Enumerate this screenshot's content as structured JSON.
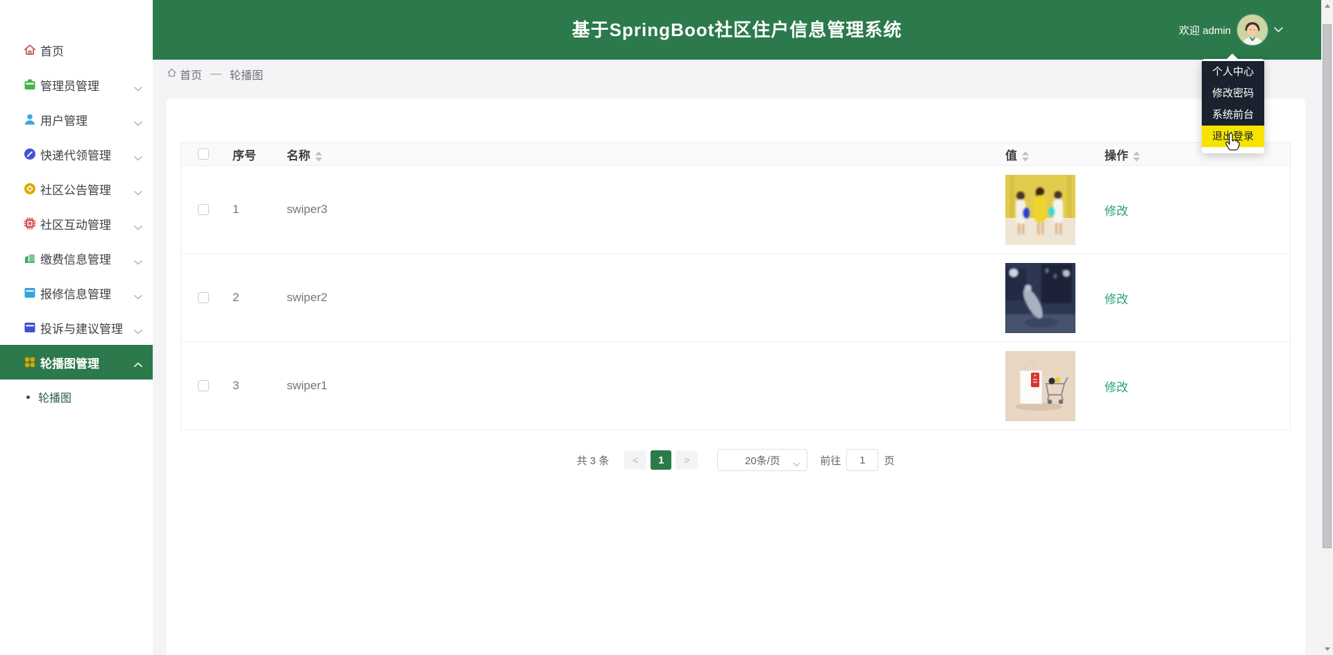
{
  "app": {
    "title": "基于SpringBoot社区住户信息管理系统",
    "welcome": "欢迎 admin"
  },
  "user_menu": {
    "items": [
      {
        "label": "个人中心"
      },
      {
        "label": "修改密码"
      },
      {
        "label": "系统前台"
      },
      {
        "label": "退出登录",
        "highlighted": true
      }
    ]
  },
  "sidebar": {
    "items": [
      {
        "label": "首页",
        "icon": "home-icon",
        "icon_color": "#c4564e",
        "expandable": false
      },
      {
        "label": "管理员管理",
        "icon": "toolbox-icon",
        "icon_color": "#44b549",
        "expandable": true
      },
      {
        "label": "用户管理",
        "icon": "user-icon",
        "icon_color": "#3aa7e0",
        "expandable": true
      },
      {
        "label": "快递代领管理",
        "icon": "pen-circle-icon",
        "icon_color": "#4353d9",
        "expandable": true
      },
      {
        "label": "社区公告管理",
        "icon": "coin-icon",
        "icon_color": "#dfa800",
        "expandable": true
      },
      {
        "label": "社区互动管理",
        "icon": "chip-icon",
        "icon_color": "#d9534f",
        "expandable": true
      },
      {
        "label": "缴费信息管理",
        "icon": "buildings-icon",
        "icon_color": "#3fae60",
        "expandable": true
      },
      {
        "label": "报修信息管理",
        "icon": "window-icon",
        "icon_color": "#36a3dd",
        "expandable": true
      },
      {
        "label": "投诉与建议管理",
        "icon": "window-icon",
        "icon_color": "#3f51cf",
        "expandable": true
      },
      {
        "label": "轮播图管理",
        "icon": "clover-icon",
        "icon_color": "#d7a400",
        "expandable": true,
        "expanded": true,
        "selected": true
      }
    ],
    "sub_item": {
      "label": "轮播图",
      "active": true
    }
  },
  "breadcrumb": {
    "home": "首页",
    "separator": "—",
    "current": "轮播图"
  },
  "table": {
    "headers": [
      {
        "label": "序号",
        "sortable": false
      },
      {
        "label": "名称",
        "sortable": true
      },
      {
        "label": "值",
        "sortable": true
      },
      {
        "label": "操作",
        "sortable": true
      }
    ],
    "rows": [
      {
        "index": "1",
        "name": "swiper3",
        "image_desc": "three-women-shopping-yellow-wall-photo",
        "action": "修改"
      },
      {
        "index": "2",
        "name": "swiper2",
        "image_desc": "night-street-statue-photo",
        "action": "修改"
      },
      {
        "index": "3",
        "name": "swiper1",
        "image_desc": "shopping-bag-and-cart-photo",
        "action": "修改"
      }
    ]
  },
  "pagination": {
    "total": "共 3 条",
    "prev": "<",
    "current_page": "1",
    "next": ">",
    "page_size": "20条/页",
    "goto_label": "前往",
    "goto_value": "1",
    "goto_unit": "页"
  },
  "colors": {
    "header_green": "#2c7a4b",
    "dropdown_dark": "#19222e",
    "highlight_yellow": "#f6e400",
    "link_teal": "#28a077"
  }
}
